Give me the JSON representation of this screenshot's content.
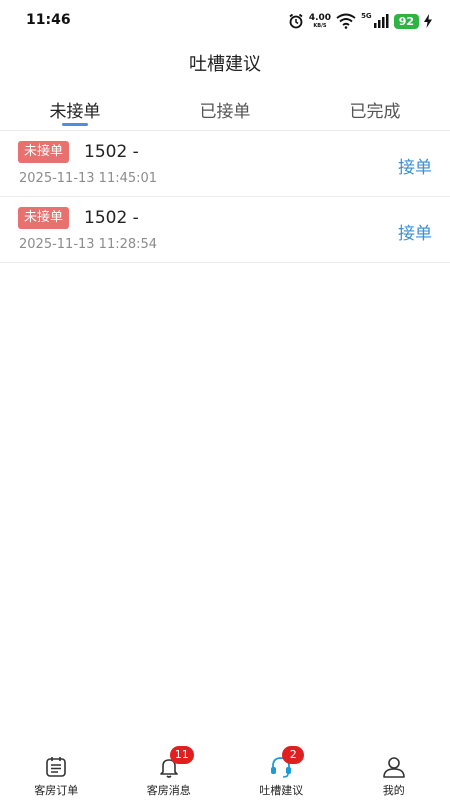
{
  "status_bar": {
    "time": "11:46",
    "net_speed": "4.00",
    "net_unit": "KB/S",
    "network": "5G",
    "battery": "92"
  },
  "header": {
    "title": "吐槽建议"
  },
  "tabs": [
    {
      "label": "未接单",
      "active": true
    },
    {
      "label": "已接单",
      "active": false
    },
    {
      "label": "已完成",
      "active": false
    }
  ],
  "orders": [
    {
      "status": "未接单",
      "room": "1502 -",
      "time": "2025-11-13 11:45:01",
      "action": "接单"
    },
    {
      "status": "未接单",
      "room": "1502 -",
      "time": "2025-11-13 11:28:54",
      "action": "接单"
    }
  ],
  "bottom_nav": [
    {
      "label": "客房订单",
      "icon": "calendar-icon",
      "badge": ""
    },
    {
      "label": "客房消息",
      "icon": "bell-icon",
      "badge": "11"
    },
    {
      "label": "吐槽建议",
      "icon": "headset-icon",
      "badge": "2",
      "active": true
    },
    {
      "label": "我的",
      "icon": "user-icon",
      "badge": ""
    }
  ],
  "colors": {
    "accent": "#4a90e2",
    "accept_text": "#3a8fd6",
    "badge_bg": "#e8706f",
    "notify_badge": "#e02020",
    "battery": "#2fb344",
    "nav_active_icon": "#1a9bd7"
  }
}
